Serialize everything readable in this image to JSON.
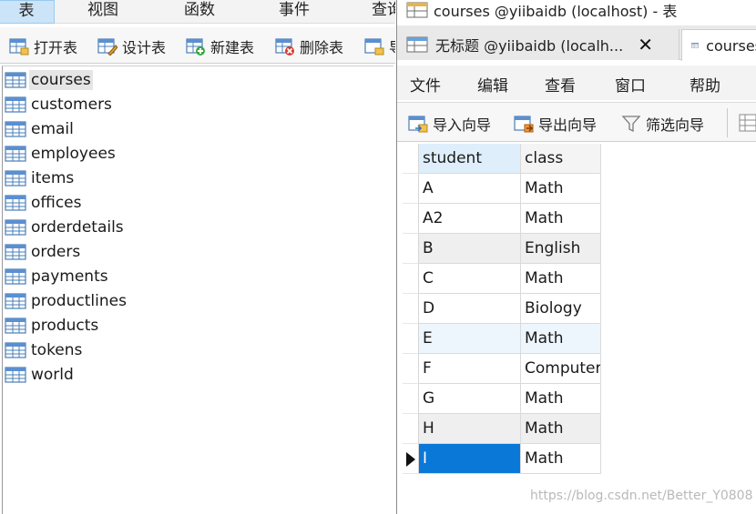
{
  "left_window": {
    "menu": [
      "表",
      "视图",
      "函数",
      "事件",
      "查询"
    ],
    "active_menu_index": 0,
    "toolbar": {
      "open_label": "打开表",
      "design_label": "设计表",
      "new_label": "新建表",
      "delete_label": "删除表",
      "import_label": "导"
    },
    "tables": [
      "courses",
      "customers",
      "email",
      "employees",
      "items",
      "offices",
      "orderdetails",
      "orders",
      "payments",
      "productlines",
      "products",
      "tokens",
      "world"
    ],
    "selected_table_index": 0
  },
  "right_window": {
    "title": "courses @yiibaidb (localhost) - 表",
    "tabs": [
      {
        "label": "无标题 @yiibaidb (localh...",
        "active": false,
        "close": "✕"
      },
      {
        "label": "courses",
        "active": true
      }
    ],
    "menu": [
      "文件",
      "编辑",
      "查看",
      "窗口",
      "帮助"
    ],
    "toolbar": {
      "import_wizard_label": "导入向导",
      "export_wizard_label": "导出向导",
      "filter_wizard_label": "筛选向导"
    },
    "grid": {
      "columns": [
        "student",
        "class"
      ],
      "rows": [
        {
          "student": "A",
          "class": "Math"
        },
        {
          "student": "A2",
          "class": "Math"
        },
        {
          "student": "B",
          "class": "English"
        },
        {
          "student": "C",
          "class": "Math"
        },
        {
          "student": "D",
          "class": "Biology"
        },
        {
          "student": "E",
          "class": "Math"
        },
        {
          "student": "F",
          "class": "Computer"
        },
        {
          "student": "G",
          "class": "Math"
        },
        {
          "student": "H",
          "class": "Math"
        },
        {
          "student": "I",
          "class": "Math"
        }
      ],
      "current_row_index": 9
    }
  },
  "watermark": "https://blog.csdn.net/Better_Y0808",
  "colors": {
    "selection_blue": "#0a78d7",
    "menu_active": "#cce4f7",
    "header_selected": "#dfeefb",
    "watermark": "#b9b9b9"
  },
  "icons": {
    "table": "table-icon",
    "open_table": "open-table-icon",
    "design_table": "design-table-icon",
    "new_table": "new-table-icon",
    "delete_table": "delete-table-icon",
    "import_wizard": "import-wizard-icon",
    "export_wizard": "export-wizard-icon",
    "filter_wizard": "filter-funnel-icon",
    "current_row": "row-pointer-icon"
  }
}
